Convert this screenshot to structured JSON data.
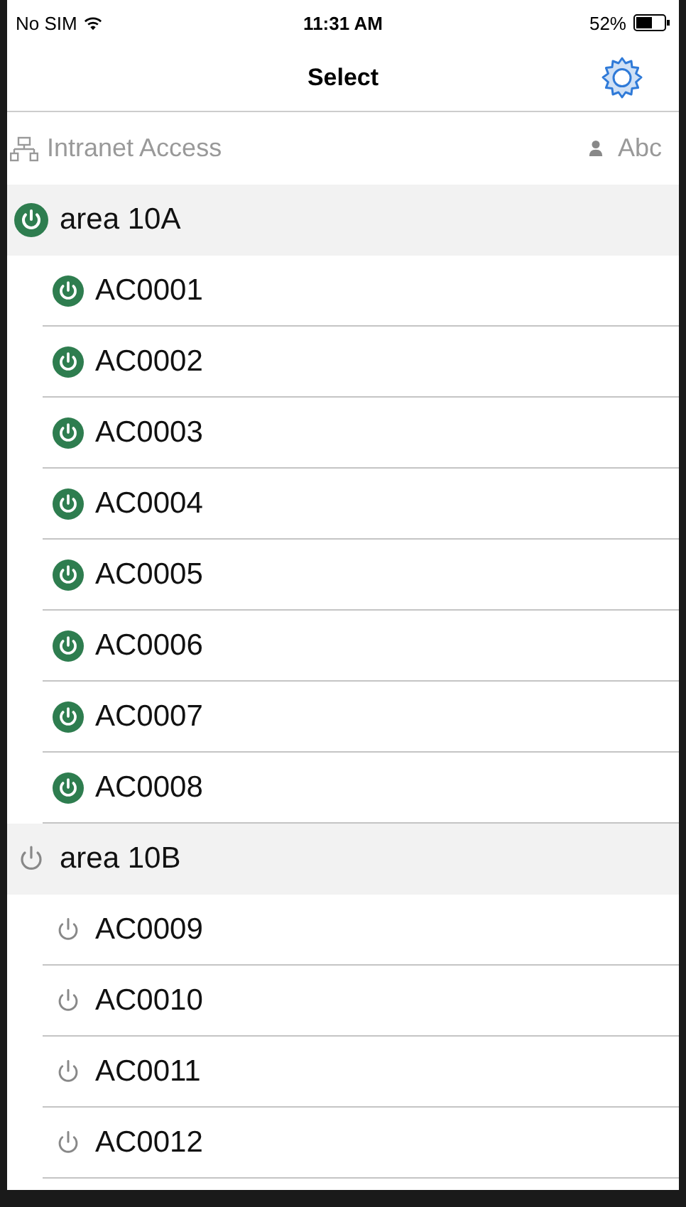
{
  "status_bar": {
    "carrier": "No SIM",
    "time": "11:31 AM",
    "battery": "52%"
  },
  "nav_bar": {
    "title": "Select"
  },
  "info_bar": {
    "connection": "Intranet Access",
    "user": "Abc"
  },
  "groups": [
    {
      "name": "area 10A",
      "on": true,
      "devices": [
        {
          "name": "AC0001",
          "on": true
        },
        {
          "name": "AC0002",
          "on": true
        },
        {
          "name": "AC0003",
          "on": true
        },
        {
          "name": "AC0004",
          "on": true
        },
        {
          "name": "AC0005",
          "on": true
        },
        {
          "name": "AC0006",
          "on": true
        },
        {
          "name": "AC0007",
          "on": true
        },
        {
          "name": "AC0008",
          "on": true
        }
      ]
    },
    {
      "name": "area 10B",
      "on": false,
      "devices": [
        {
          "name": "AC0009",
          "on": false
        },
        {
          "name": "AC0010",
          "on": false
        },
        {
          "name": "AC0011",
          "on": false
        },
        {
          "name": "AC0012",
          "on": false
        }
      ]
    }
  ]
}
